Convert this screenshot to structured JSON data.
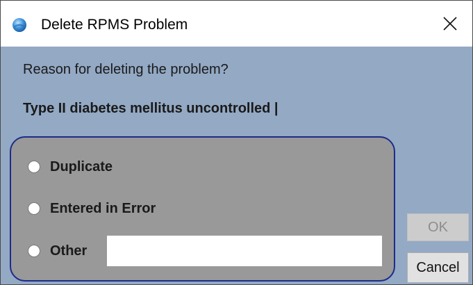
{
  "window": {
    "title": "Delete RPMS Problem",
    "app_icon": "globe-icon",
    "close_icon": "close-icon"
  },
  "prompt": "Reason for deleting the problem?",
  "problem_name": "Type II diabetes mellitus uncontrolled |",
  "reasons": [
    {
      "label": "Duplicate",
      "selected": false
    },
    {
      "label": "Entered in Error",
      "selected": false
    },
    {
      "label": "Other",
      "selected": false
    }
  ],
  "other_input": {
    "value": ""
  },
  "buttons": {
    "ok_label": "OK",
    "ok_enabled": false,
    "cancel_label": "Cancel"
  },
  "colors": {
    "dialog_background": "#93a9c4",
    "group_background": "#999999",
    "group_border": "#1d2b8a"
  }
}
